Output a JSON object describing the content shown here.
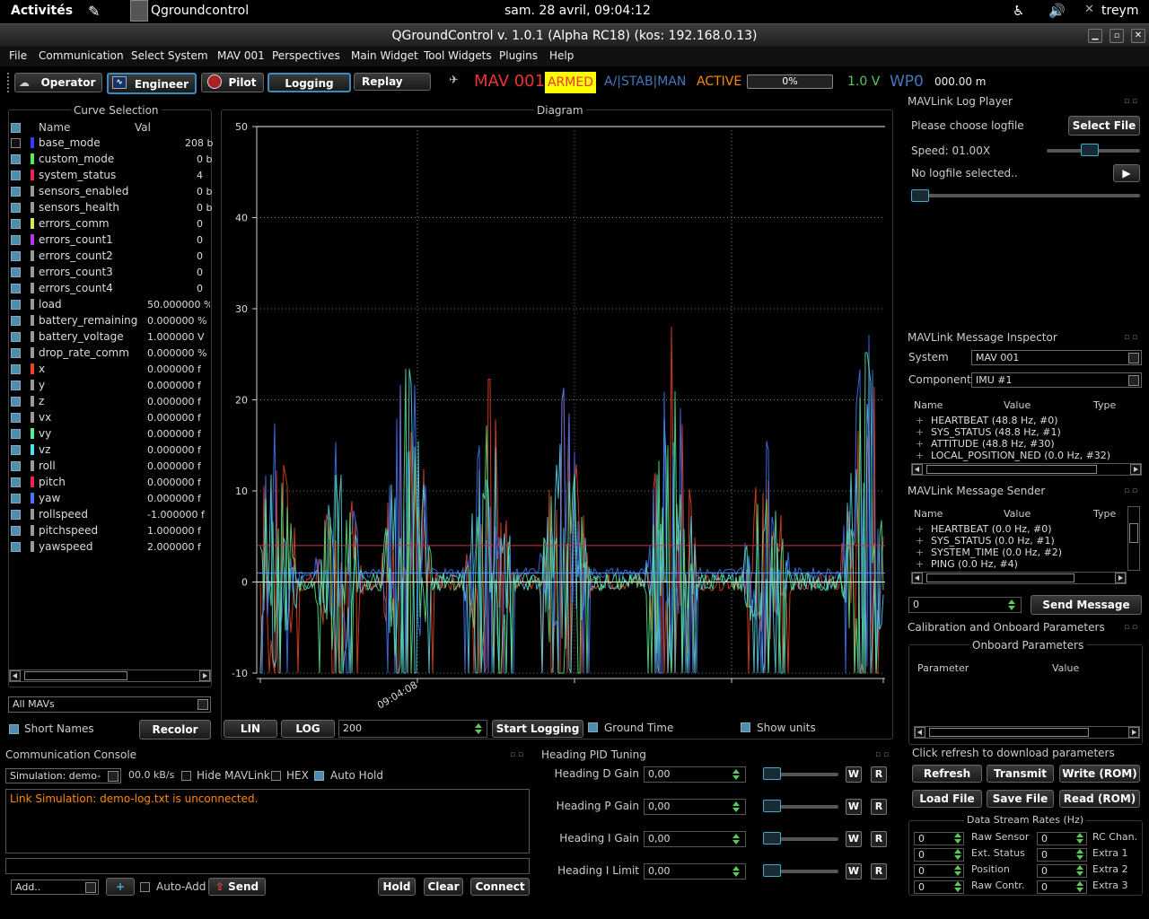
{
  "topbar": {
    "activities": "Activités",
    "app": "Qgroundcontrol",
    "datetime": "sam. 28 avril, 09:04:12",
    "user": "treym"
  },
  "window": {
    "title": "QGroundControl v. 1.0.1 (Alpha RC18) (kos: 192.168.0.13)"
  },
  "menu": [
    "File",
    "Communication",
    "Select System",
    "MAV 001",
    "Perspectives",
    "Main Widget",
    "Tool Widgets",
    "Plugins",
    "Help"
  ],
  "toolbar": {
    "operator": "Operator",
    "engineer": "Engineer",
    "pilot": "Pilot",
    "logging": "Logging",
    "replay": "Replay",
    "mav": "MAV 001",
    "armed": "ARMED",
    "mode": "A/|STAB|MAN",
    "state": "ACTIVE",
    "progress": "0%",
    "progress_value": 0,
    "voltage": "1.0 V",
    "wp": "WP0",
    "distance": "000.00 m"
  },
  "curves": {
    "title": "Curve Selection",
    "col_name": "Name",
    "col_val": "Val",
    "items": [
      {
        "name": "base_mode",
        "val": "208 b",
        "color": "#3a3aff",
        "on": false
      },
      {
        "name": "custom_mode",
        "val": "0 b",
        "color": "#55ee55",
        "on": true
      },
      {
        "name": "system_status",
        "val": "4",
        "color": "#ee2255",
        "on": true
      },
      {
        "name": "sensors_enabled",
        "val": "0 b",
        "color": "#999999",
        "on": true
      },
      {
        "name": "sensors_health",
        "val": "0 b",
        "color": "#999999",
        "on": true
      },
      {
        "name": "errors_comm",
        "val": "0",
        "color": "#ccee55",
        "on": true
      },
      {
        "name": "errors_count1",
        "val": "0",
        "color": "#bb33ee",
        "on": true
      },
      {
        "name": "errors_count2",
        "val": "0",
        "color": "#999999",
        "on": true
      },
      {
        "name": "errors_count3",
        "val": "0",
        "color": "#999999",
        "on": true
      },
      {
        "name": "errors_count4",
        "val": "0",
        "color": "#999999",
        "on": true
      },
      {
        "name": "load",
        "val": "50.000000 %",
        "color": "#999999",
        "on": true
      },
      {
        "name": "battery_remaining",
        "val": "0.000000 %",
        "color": "#999999",
        "on": true
      },
      {
        "name": "battery_voltage",
        "val": "1.000000 V",
        "color": "#999999",
        "on": true
      },
      {
        "name": "drop_rate_comm",
        "val": "0.000000 %",
        "color": "#999999",
        "on": true
      },
      {
        "name": "x",
        "val": "0.000000 f",
        "color": "#ee4422",
        "on": true
      },
      {
        "name": "y",
        "val": "0.000000 f",
        "color": "#999999",
        "on": true
      },
      {
        "name": "z",
        "val": "0.000000 f",
        "color": "#999999",
        "on": true
      },
      {
        "name": "vx",
        "val": "0.000000 f",
        "color": "#999999",
        "on": true
      },
      {
        "name": "vy",
        "val": "0.000000 f",
        "color": "#55ee88",
        "on": true
      },
      {
        "name": "vz",
        "val": "0.000000 f",
        "color": "#55ddee",
        "on": true
      },
      {
        "name": "roll",
        "val": "0.000000 f",
        "color": "#999999",
        "on": true
      },
      {
        "name": "pitch",
        "val": "0.000000 f",
        "color": "#ee2255",
        "on": true
      },
      {
        "name": "yaw",
        "val": "0.000000 f",
        "color": "#4477ff",
        "on": true
      },
      {
        "name": "rollspeed",
        "val": "-1.000000 f",
        "color": "#999999",
        "on": true
      },
      {
        "name": "pitchspeed",
        "val": "1.000000 f",
        "color": "#999999",
        "on": true
      },
      {
        "name": "yawspeed",
        "val": "2.000000 f",
        "color": "#999999",
        "on": true
      }
    ],
    "mav_select": "All MAVs",
    "short_names": "Short Names",
    "recolor": "Recolor"
  },
  "diagram": {
    "title": "Diagram",
    "lin": "LIN",
    "log": "LOG",
    "points": "200",
    "start_logging": "Start Logging",
    "ground_time": "Ground Time",
    "show_units": "Show units"
  },
  "chart_data": {
    "type": "line",
    "title": "Diagram",
    "ylim": [
      -10,
      50
    ],
    "yticks": [
      "50",
      "40",
      "30",
      "20",
      "10",
      "0",
      "-10"
    ],
    "xtick_label": "09:04:08",
    "reference_lines": [
      {
        "y": 4,
        "color": "#cc3344"
      },
      {
        "y": 1,
        "color": "#5599ff"
      },
      {
        "y": 0,
        "color": "#eeeeee"
      }
    ],
    "burst_x": [
      0.03,
      0.13,
      0.24,
      0.37,
      0.49,
      0.66,
      0.81,
      0.97
    ],
    "burst_peaks": [
      18,
      17,
      29,
      23,
      22,
      28,
      16,
      30
    ],
    "series_colors": [
      "#ee4422",
      "#55ddee",
      "#4477ff",
      "#55ee88"
    ]
  },
  "logplayer": {
    "title": "MAVLink Log Player",
    "choose": "Please choose logfile",
    "select": "Select File",
    "speed": "Speed: 01.00X",
    "speed_value": 0.45,
    "nofile": "No logfile selected.."
  },
  "inspector": {
    "title": "MAVLink Message Inspector",
    "system_label": "System",
    "system": "MAV 001",
    "component_label": "Component",
    "component": "IMU #1",
    "col_name": "Name",
    "col_value": "Value",
    "col_type": "Type",
    "items": [
      "HEARTBEAT (48.8 Hz, #0)",
      "SYS_STATUS (48.8 Hz, #1)",
      "ATTITUDE (48.8 Hz, #30)",
      "LOCAL_POSITION_NED (0.0 Hz, #32)"
    ]
  },
  "sender": {
    "title": "MAVLink Message Sender",
    "col_name": "Name",
    "col_value": "Value",
    "col_type": "Type",
    "items": [
      "HEARTBEAT (0.0 Hz, #0)",
      "SYS_STATUS (0.0 Hz, #1)",
      "SYSTEM_TIME (0.0 Hz, #2)",
      "PING (0.0 Hz, #4)"
    ],
    "count": "0",
    "send": "Send Message"
  },
  "calib": {
    "title": "Calibration and Onboard Parameters",
    "onboard": "Onboard Parameters",
    "col_param": "Parameter",
    "col_value": "Value",
    "hint": "Click refresh to download parameters",
    "buttons": [
      "Refresh",
      "Transmit",
      "Write (ROM)",
      "Load File",
      "Save File",
      "Read (ROM)"
    ],
    "rates_title": "Data Stream Rates (Hz)",
    "rates": [
      {
        "l": "Raw Sensor",
        "r": "RC Chan.",
        "lv": "0",
        "rv": "0"
      },
      {
        "l": "Ext. Status",
        "r": "Extra 1",
        "lv": "0",
        "rv": "0"
      },
      {
        "l": "Position",
        "r": "Extra 2",
        "lv": "0",
        "rv": "0"
      },
      {
        "l": "Raw Contr.",
        "r": "Extra 3",
        "lv": "0",
        "rv": "0"
      }
    ]
  },
  "console": {
    "title": "Communication Console",
    "link": "Simulation: demo-",
    "rate": "00.0 kB/s",
    "hide": "Hide MAVLink",
    "hex": "HEX",
    "autohold": "Auto Hold",
    "message": "Link Simulation: demo-log.txt is unconnected.",
    "add": "Add..",
    "plus": "+",
    "autoadd": "Auto-Add",
    "send": "Send",
    "hold": "Hold",
    "clear": "Clear",
    "connect": "Connect"
  },
  "pid": {
    "title": "Heading PID Tuning",
    "rows": [
      {
        "label": "Heading D Gain",
        "value": "0,00"
      },
      {
        "label": "Heading P Gain",
        "value": "0,00"
      },
      {
        "label": "Heading I Gain",
        "value": "0,00"
      },
      {
        "label": "Heading I Limit",
        "value": "0,00"
      }
    ],
    "w": "W",
    "r": "R"
  }
}
